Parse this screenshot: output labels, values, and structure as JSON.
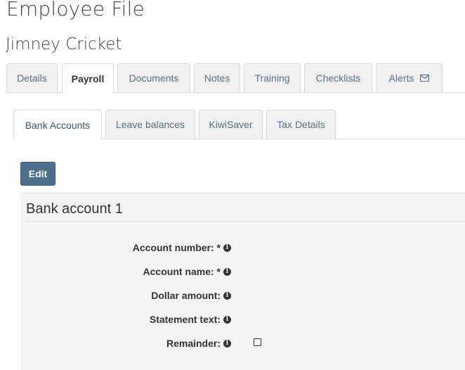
{
  "page": {
    "title": "Employee File",
    "employee_name": "Jimney Cricket"
  },
  "main_tabs": [
    {
      "label": "Details"
    },
    {
      "label": "Payroll",
      "active": true
    },
    {
      "label": "Documents"
    },
    {
      "label": "Notes"
    },
    {
      "label": "Training"
    },
    {
      "label": "Checklists"
    },
    {
      "label": "Alerts",
      "icon": "envelope-icon"
    }
  ],
  "sub_tabs": [
    {
      "label": "Bank Accounts",
      "active": true
    },
    {
      "label": "Leave balances"
    },
    {
      "label": "KiwiSaver"
    },
    {
      "label": "Tax Details"
    }
  ],
  "actions": {
    "edit_label": "Edit"
  },
  "bank_account": {
    "title": "Bank account 1",
    "fields": [
      {
        "label": "Account number: *",
        "icon": "info-icon"
      },
      {
        "label": "Account name: *",
        "icon": "info-icon"
      },
      {
        "label": "Dollar amount:",
        "icon": "info-icon"
      },
      {
        "label": "Statement text:",
        "icon": "info-icon"
      },
      {
        "label": "Remainder:",
        "icon": "info-icon",
        "checkbox_checked": false
      }
    ]
  },
  "colors": {
    "primary_button": "#4d6f8e",
    "tab_text": "#5a6f85",
    "panel_background": "#f5f5f5"
  }
}
